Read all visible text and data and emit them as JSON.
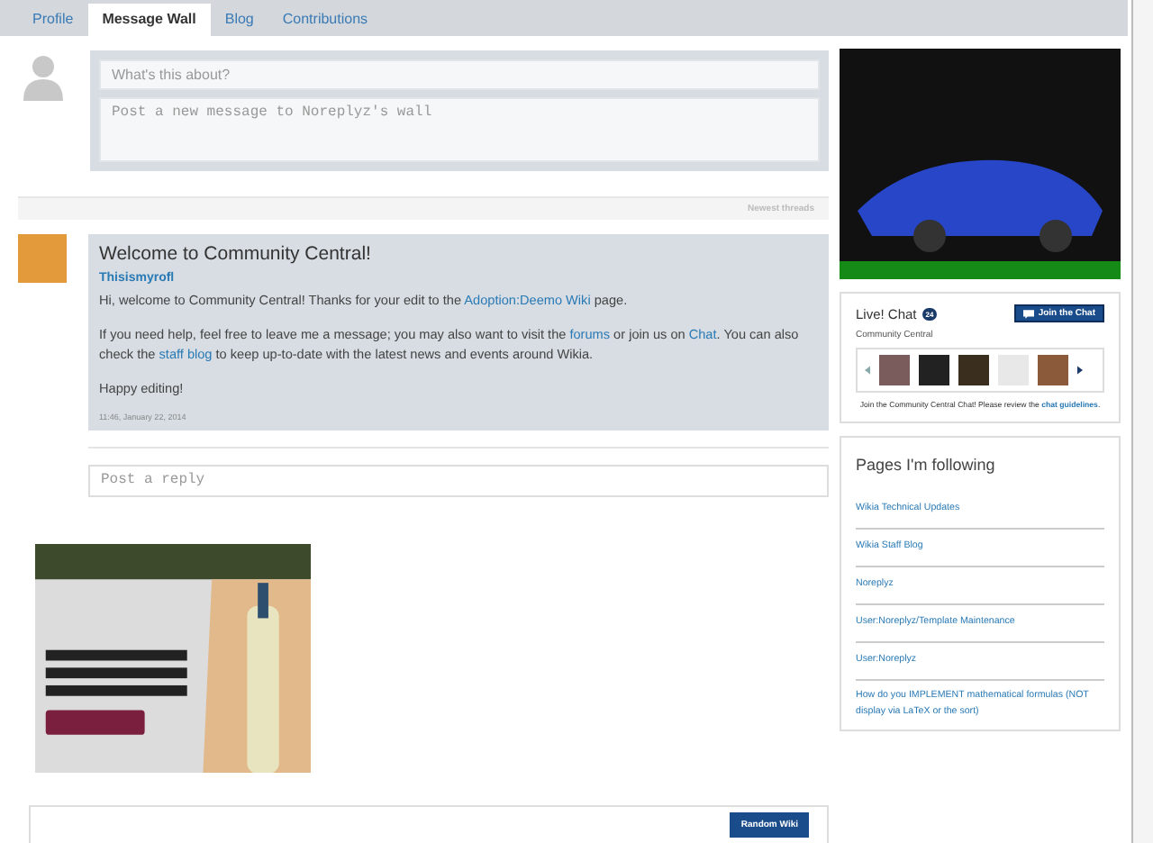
{
  "tabs": [
    {
      "label": "Profile",
      "selected": false
    },
    {
      "label": "Message Wall",
      "selected": true
    },
    {
      "label": "Blog",
      "selected": false
    },
    {
      "label": "Contributions",
      "selected": false
    }
  ],
  "compose": {
    "title_placeholder": "What's this about?",
    "body_placeholder": "Post a new message to Noreplyz's wall"
  },
  "sort_label": "Newest threads",
  "thread": {
    "title": "Welcome to Community Central!",
    "author": "Thisismyrofl",
    "paragraphs": [
      [
        {
          "text": "Hi, welcome to Community Central! Thanks for your edit to the ",
          "link": false
        },
        {
          "text": "Adoption:Deemo Wiki",
          "link": true
        },
        {
          "text": " page.",
          "link": false
        }
      ],
      [
        {
          "text": "If you need help, feel free to leave me a message; you may also want to visit the ",
          "link": false
        },
        {
          "text": "forums",
          "link": true
        },
        {
          "text": " or join us on ",
          "link": false
        },
        {
          "text": "Chat",
          "link": true
        },
        {
          "text": ". You can also check the ",
          "link": false
        },
        {
          "text": "staff blog",
          "link": true
        },
        {
          "text": " to keep up-to-date with the latest news and events around Wikia.",
          "link": false
        }
      ],
      [
        {
          "text": "Happy editing!",
          "link": false
        }
      ]
    ],
    "timestamp": "11:46, January 22, 2014",
    "reply_placeholder": "Post a reply"
  },
  "chat": {
    "title": "Live! Chat",
    "count": "24",
    "join_button": "Join the Chat",
    "wiki": "Community Central",
    "note": [
      {
        "text": "Join the Community Central Chat! Please review the ",
        "link": false
      },
      {
        "text": "chat guidelines",
        "link": true
      },
      {
        "text": ".",
        "link": false
      }
    ]
  },
  "following": {
    "title": "Pages I'm following",
    "items": [
      "Wikia Technical Updates",
      "Wikia Staff Blog",
      "Noreplyz",
      "User:Noreplyz/Template Maintenance",
      "User:Noreplyz",
      "How do you IMPLEMENT mathematical formulas (NOT display via LaTeX or the sort)"
    ]
  },
  "bottom_button": "Random Wiki"
}
